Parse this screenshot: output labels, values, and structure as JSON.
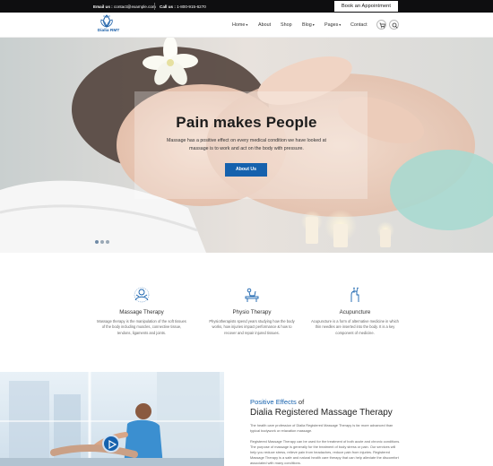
{
  "topbar": {
    "email_label": "Email us :",
    "email_value": "contact@example.com",
    "call_label": "Call us :",
    "call_value": "1-800-915-6270",
    "appointment_button": "Book an Appointment"
  },
  "brand": {
    "name": "Dialia RMT",
    "color": "#1a5fa8"
  },
  "nav": {
    "items": [
      {
        "label": "Home",
        "dropdown": true
      },
      {
        "label": "About",
        "dropdown": false
      },
      {
        "label": "Shop",
        "dropdown": false
      },
      {
        "label": "Blog",
        "dropdown": true
      },
      {
        "label": "Pages",
        "dropdown": true
      },
      {
        "label": "Contact",
        "dropdown": false
      }
    ],
    "cart_icon": "cart-icon",
    "search_icon": "search-icon"
  },
  "hero": {
    "title": "Pain makes People",
    "text": "Massage has a positive effect on every medical condition we have looked at massage is to work and act on the body with pressure.",
    "button": "About Us",
    "slides": 3,
    "active_slide": 1
  },
  "services": [
    {
      "icon": "massage-icon",
      "title": "Massage Therapy",
      "description": "Massage therapy is the manipulation of the soft tissues of the body including muscles, connective tissue, tendons, ligaments and joints."
    },
    {
      "icon": "physio-icon",
      "title": "Physio Therapy",
      "description": "Physiotherapists spend years studying how the body works, how injuries impact performance & how to recover and repair injured tissues."
    },
    {
      "icon": "acupuncture-icon",
      "title": "Acupuncture",
      "description": "Acupuncture is a form of alternative medicine in which thin needles are inserted into the body. It is a key component of medicine."
    }
  ],
  "about": {
    "kicker_accent": "Positive Effects",
    "kicker_rest": " of",
    "title": "Dialia Registered Massage Therapy",
    "paragraph1": "The health care profession of Dialia Registered Massage Therapy is far more advanced than typical bodywork or relaxation massage.",
    "paragraph2": "Registered Massage Therapy can be used for the treatment of both acute and chronic conditions. The purpose of massage is generally for the treatment of body stress or pain. Our services will help you reduce stress, relieve pain from headaches, reduce pain from injuries. Registered Massage Therapy is a safe and natural health care therapy that can help alleviate the discomfort associated with many conditions.",
    "play_icon": "play-icon"
  },
  "colors": {
    "accent": "#1561ad",
    "topbar": "#0e0e10"
  }
}
